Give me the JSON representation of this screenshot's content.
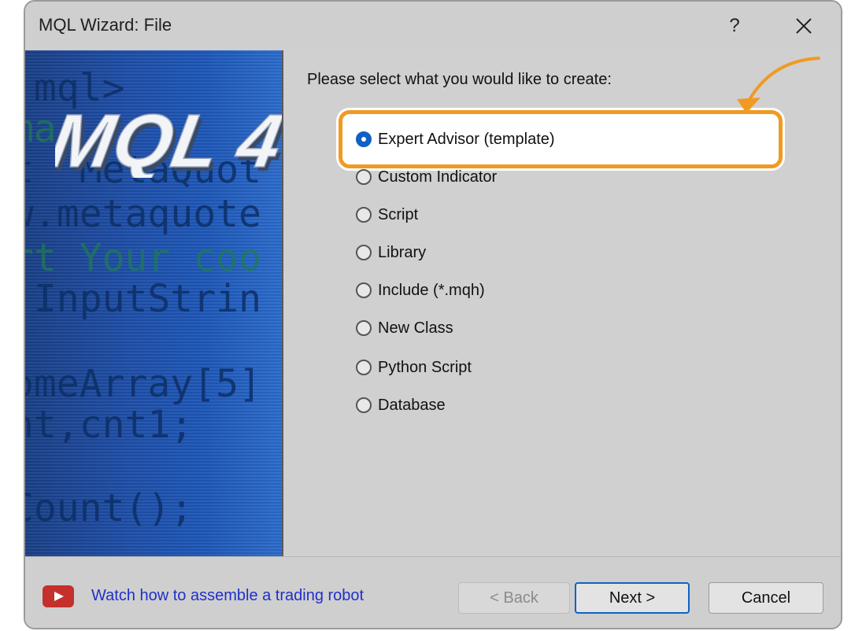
{
  "window": {
    "title": "MQL Wizard: File",
    "help_label": "?"
  },
  "banner": {
    "logo_text": "MQL 4",
    "code_lines": [
      ".mql>",
      "ma",
      "t  MetaQuot",
      "w.metaquote",
      "rt Your coo",
      " InputStrin",
      "omeArray[5]",
      "nt,cnt1;",
      "Count();"
    ]
  },
  "content": {
    "prompt": "Please select what you would like to create:",
    "options": [
      {
        "label": "Expert Advisor (template)",
        "selected": true
      },
      {
        "label": "Custom Indicator",
        "selected": false
      },
      {
        "label": "Script",
        "selected": false
      },
      {
        "label": "Library",
        "selected": false
      },
      {
        "label": "Include (*.mqh)",
        "selected": false
      },
      {
        "label": "New Class",
        "selected": false
      },
      {
        "label": "Python Script",
        "selected": false
      },
      {
        "label": "Database",
        "selected": false
      }
    ]
  },
  "footer": {
    "video_icon": "youtube-play-icon",
    "link_text": "Watch how to assemble a trading robot",
    "back_label": "< Back",
    "next_label": "Next >",
    "cancel_label": "Cancel"
  },
  "colors": {
    "highlight": "#f09a22",
    "link": "#1f30c9",
    "accent": "#1061c4"
  }
}
